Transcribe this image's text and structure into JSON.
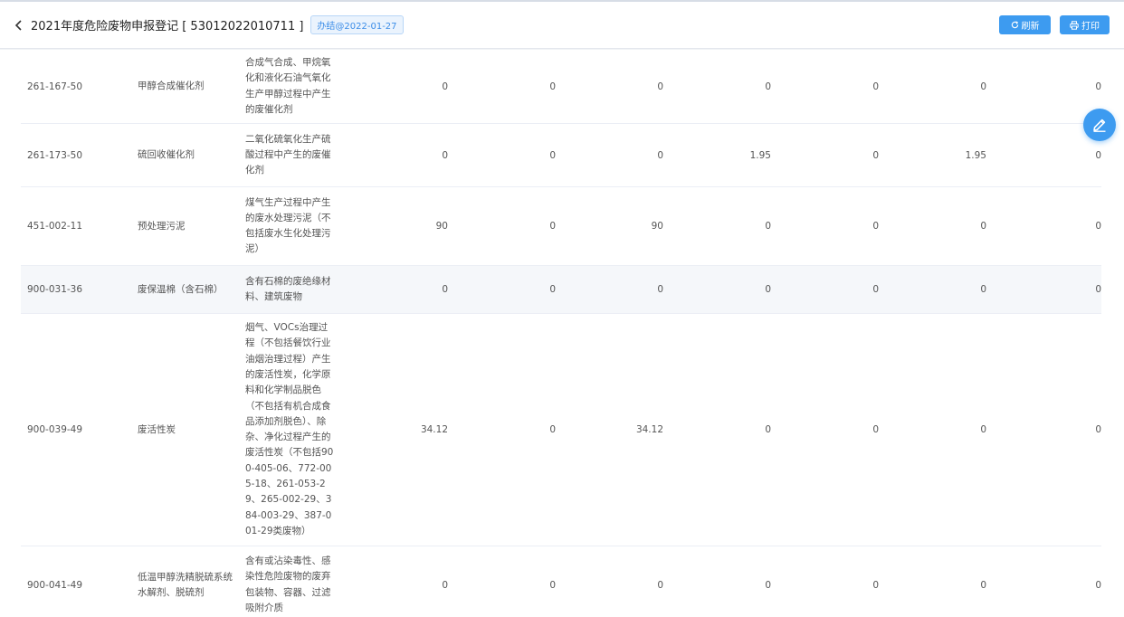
{
  "header": {
    "title": "2021年度危险废物申报登记 [ 53012022010711 ]",
    "badge": "办结@2022-01-27",
    "refresh_label": "刷新",
    "print_label": "打印"
  },
  "table": {
    "rows": [
      {
        "code": "261-167-50",
        "name": "甲醇合成催化剂",
        "desc": "合成气合成、甲烷氧化和液化石油气氧化生产甲醇过程中产生的废催化剂",
        "values": [
          "0",
          "0",
          "0",
          "0",
          "0",
          "0",
          "0"
        ]
      },
      {
        "code": "261-173-50",
        "name": "硫回收催化剂",
        "desc": "二氧化硫氧化生产硫酸过程中产生的废催化剂",
        "values": [
          "0",
          "0",
          "0",
          "1.95",
          "0",
          "1.95",
          "0"
        ]
      },
      {
        "code": "451-002-11",
        "name": "预处理污泥",
        "desc": "煤气生产过程中产生的废水处理污泥（不包括废水生化处理污泥）",
        "values": [
          "90",
          "0",
          "90",
          "0",
          "0",
          "0",
          "0"
        ]
      },
      {
        "code": "900-031-36",
        "name": "废保温棉（含石棉）",
        "desc": "含有石棉的废绝缘材料、建筑废物",
        "values": [
          "0",
          "0",
          "0",
          "0",
          "0",
          "0",
          "0"
        ]
      },
      {
        "code": "900-039-49",
        "name": "废活性炭",
        "desc": "烟气、VOCs治理过程（不包括餐饮行业油烟治理过程）产生的废活性炭，化学原料和化学制品脱色（不包括有机合成食品添加剂脱色）、除杂、净化过程产生的废活性炭（不包括900-405-06、772-005-18、261-053-29、265-002-29、384-003-29、387-001-29类废物）",
        "values": [
          "34.12",
          "0",
          "34.12",
          "0",
          "0",
          "0",
          "0"
        ]
      },
      {
        "code": "900-041-49",
        "name": "低温甲醇洗精脱硫系统水解剂、脱硫剂",
        "desc": "含有或沾染毒性、感染性危险废物的废弃包装物、容器、过滤吸附介质",
        "values": [
          "0",
          "0",
          "0",
          "0",
          "0",
          "0",
          "0"
        ]
      }
    ]
  },
  "icons": {
    "back": "chevron-left-icon",
    "refresh": "refresh-icon",
    "print": "printer-icon",
    "edit": "pencil-icon"
  },
  "colors": {
    "accent": "#3d9bf0",
    "badge_text": "#3d8ee8",
    "row_highlight": "#f5f7fa"
  }
}
